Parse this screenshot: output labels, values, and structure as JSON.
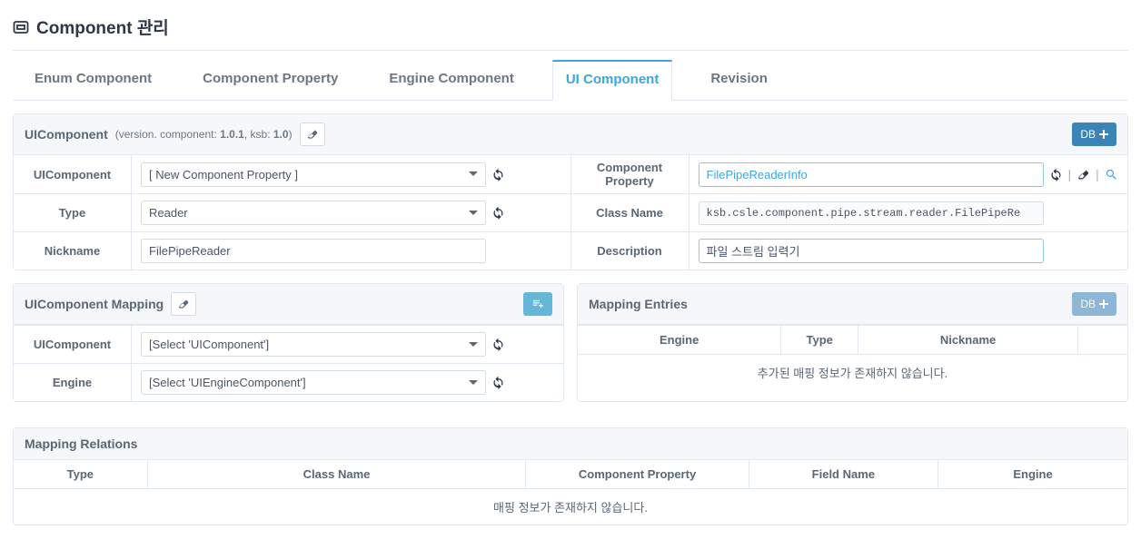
{
  "page": {
    "title": "Component 관리"
  },
  "tabs": {
    "enum": "Enum Component",
    "property": "Component Property",
    "engine": "Engine Component",
    "ui": "UI Component",
    "revision": "Revision"
  },
  "uicomponent_panel": {
    "title": "UIComponent",
    "version_prefix": "(version. component: ",
    "version_component": "1.0.1",
    "version_mid": ", ksb: ",
    "version_ksb": "1.0",
    "version_suffix": ")",
    "db_label": "DB",
    "labels": {
      "uicomponent": "UIComponent",
      "type": "Type",
      "nickname": "Nickname",
      "component_property": "Component Property",
      "class_name": "Class Name",
      "description": "Description"
    },
    "values": {
      "uicomponent_select": "[ New Component Property ]",
      "type_select": "Reader",
      "nickname": "FilePipeReader",
      "component_property": "FilePipeReaderInfo",
      "class_name": "ksb.csle.component.pipe.stream.reader.FilePipeRe",
      "description": "파일 스트림 입력기"
    }
  },
  "mapping_panel": {
    "title": "UIComponent Mapping",
    "labels": {
      "uicomponent": "UIComponent",
      "engine": "Engine"
    },
    "values": {
      "uicomponent_select": "[Select 'UIComponent']",
      "engine_select": "[Select 'UIEngineComponent']"
    }
  },
  "entries_panel": {
    "title": "Mapping Entries",
    "db_label": "DB",
    "columns": {
      "engine": "Engine",
      "type": "Type",
      "nickname": "Nickname"
    },
    "empty_msg": "추가된 매핑 정보가 존재하지 않습니다."
  },
  "relations_panel": {
    "title": "Mapping Relations",
    "columns": {
      "type": "Type",
      "class_name": "Class Name",
      "component_property": "Component Property",
      "field_name": "Field Name",
      "engine": "Engine"
    },
    "empty_msg": "매핑 정보가 존재하지 않습니다."
  }
}
